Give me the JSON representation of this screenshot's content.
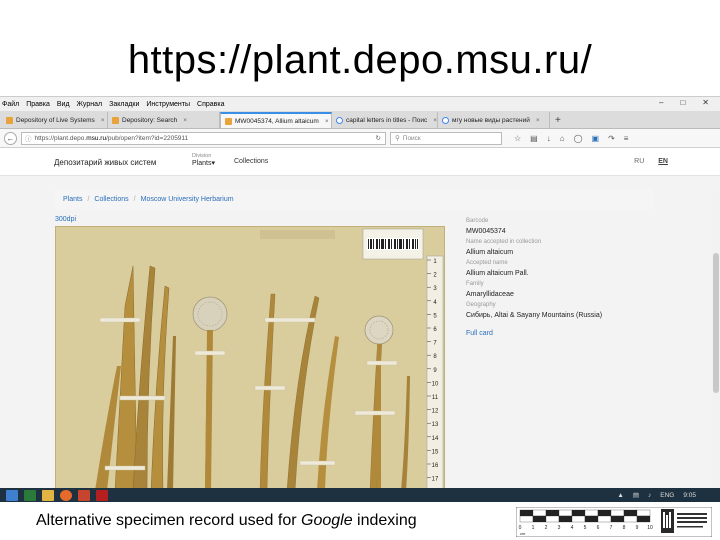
{
  "slide": {
    "title": "https://plant.depo.msu.ru/",
    "caption_before": "Alternative specimen record used for ",
    "caption_em": "Google",
    "caption_after": " indexing"
  },
  "browser": {
    "menu": [
      "Файл",
      "Правка",
      "Вид",
      "Журнал",
      "Закладки",
      "Инструменты",
      "Справка"
    ],
    "tabs": [
      {
        "label": "Depository of Live Systems",
        "active": false,
        "favicon": "depo"
      },
      {
        "label": "Depository: Search",
        "active": false,
        "favicon": "depo"
      },
      {
        "label": "MW0045374, Allium altaicum",
        "active": true,
        "favicon": "depo"
      },
      {
        "label": "capital letters in titles - Поис",
        "active": false,
        "favicon": "google"
      },
      {
        "label": "мгу новые виды растений",
        "active": false,
        "favicon": "google"
      }
    ],
    "url_prefix": "https://plant.depo.",
    "url_domain": "msu.ru",
    "url_path": "/pub/open?item?id=2205911",
    "search_placeholder": "Поиск"
  },
  "site": {
    "brand": "Депозитарий живых систем",
    "division_label": "Division",
    "division_value": "Plants",
    "collections_label": "Collections",
    "lang_ru": "RU",
    "lang_en": "EN",
    "breadcrumb": [
      "Plants",
      "Collections",
      "Moscow University Herbarium"
    ],
    "dpi_link": "300dpi"
  },
  "record": {
    "barcode_label": "Barcode",
    "barcode": "MW0045374",
    "names_label": "Name accepted in collection",
    "name": "Allium altaicum",
    "accepted_label": "Accepted name",
    "accepted": "Allium altaicum Pall.",
    "family_label": "Family",
    "family": "Amaryllidaceae",
    "geography_label": "Geography",
    "geography": "Сибирь, Altai & Sayany Mountains (Russia)",
    "full_card": "Full card"
  },
  "specimen": {
    "ruler_numbers": [
      "1",
      "2",
      "3",
      "4",
      "5",
      "6",
      "7",
      "8",
      "9",
      "10",
      "11",
      "12",
      "13",
      "14",
      "15",
      "16",
      "17"
    ],
    "scale_numbers": [
      "0",
      "1",
      "2",
      "3",
      "4",
      "5",
      "6",
      "7",
      "8",
      "9",
      "10"
    ],
    "scale_unit": "cm",
    "barcode_label_text": "Herbarium MW Moscow",
    "barcode_number": "MW 0 045 374",
    "logo_text": "Herbarium Universitatis Mosquensis (MW)"
  },
  "taskbar": {
    "lang": "ENG",
    "time": "9:05"
  },
  "colors": {
    "link": "#2a6ebb",
    "taskbar": "#1e3140",
    "paper": "#d9cc9d",
    "stem": "#b08a3a"
  }
}
